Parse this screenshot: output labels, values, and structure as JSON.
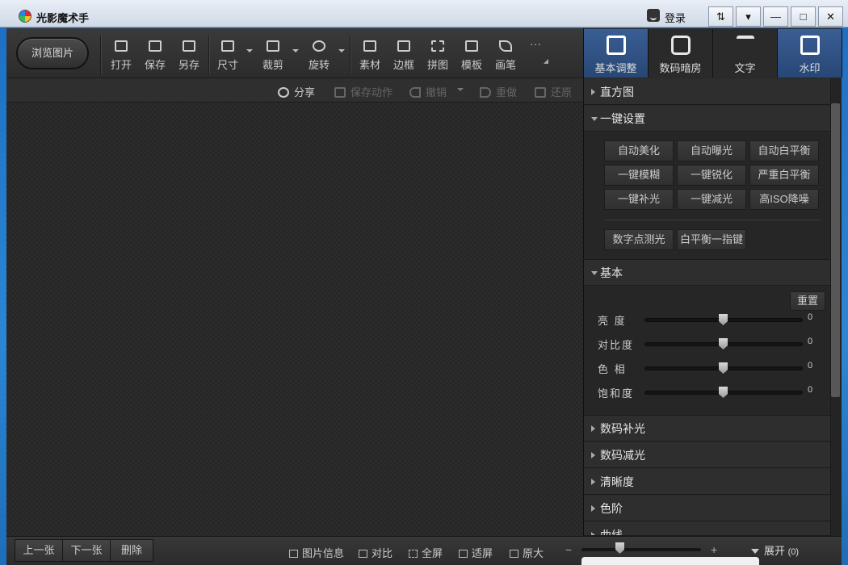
{
  "window": {
    "title": "光影魔术手",
    "login_label": "登录",
    "controls": [
      "⇅",
      "▾",
      "—",
      "□",
      "✕"
    ]
  },
  "toolbar": {
    "browse_label": "浏览图片",
    "tools": [
      {
        "label": "打开",
        "icon": "open-image-icon"
      },
      {
        "label": "保存",
        "icon": "save-icon"
      },
      {
        "label": "另存",
        "icon": "save-as-icon"
      },
      {
        "label": "尺寸",
        "icon": "resize-icon"
      },
      {
        "label": "裁剪",
        "icon": "crop-icon"
      },
      {
        "label": "旋转",
        "icon": "rotate-icon"
      },
      {
        "label": "素材",
        "icon": "sticker-icon"
      },
      {
        "label": "边框",
        "icon": "frame-icon"
      },
      {
        "label": "拼图",
        "icon": "collage-icon"
      },
      {
        "label": "模板",
        "icon": "template-icon"
      },
      {
        "label": "画笔",
        "icon": "brush-icon"
      }
    ],
    "more_label": "···"
  },
  "actions": {
    "share": "分享",
    "save_action": "保存动作",
    "undo": "撤销",
    "redo": "重做",
    "restore": "还原"
  },
  "tabs": [
    {
      "label": "基本调整",
      "icon": "basic-adjust-icon",
      "active": true
    },
    {
      "label": "数码暗房",
      "icon": "darkroom-icon",
      "active": false
    },
    {
      "label": "文字",
      "icon": "text-icon",
      "active": false
    },
    {
      "label": "水印",
      "icon": "watermark-icon",
      "active": true
    }
  ],
  "panel": {
    "histogram": "直方图",
    "oneclick": {
      "title": "一键设置",
      "buttons": [
        "自动美化",
        "自动曝光",
        "自动白平衡",
        "一键模糊",
        "一键锐化",
        "严重白平衡",
        "一键补光",
        "一键减光",
        "高ISO降噪"
      ],
      "extra_buttons": [
        "数字点测光",
        "白平衡一指键"
      ]
    },
    "basic": {
      "title": "基本",
      "reset": "重置",
      "sliders": [
        {
          "label": "亮  度",
          "value": 0
        },
        {
          "label": "对比度",
          "value": 0
        },
        {
          "label": "色  相",
          "value": 0
        },
        {
          "label": "饱和度",
          "value": 0
        }
      ]
    },
    "sections": [
      "数码补光",
      "数码减光",
      "清晰度",
      "色阶",
      "曲线"
    ]
  },
  "bottom": {
    "prev": "上一张",
    "next": "下一张",
    "delete": "删除",
    "info": "图片信息",
    "compare": "对比",
    "fullscreen": "全屏",
    "fit": "适屏",
    "original": "原大",
    "zoom_minus": "−",
    "zoom_plus": "+",
    "expand": "展开",
    "expand_count": "(0)"
  }
}
